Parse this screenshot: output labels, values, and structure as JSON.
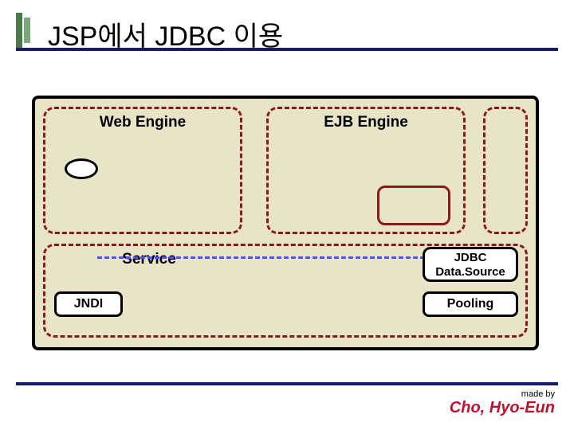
{
  "title": "JSP에서 JDBC 이용",
  "boxes": {
    "web_engine": "Web Engine",
    "ejb_engine": "EJB Engine",
    "service": "Service",
    "jdbc_ds_line1": "JDBC",
    "jdbc_ds_line2": "Data.Source",
    "jndi": "JNDI",
    "pooling": "Pooling"
  },
  "credit": {
    "made_by": "made by",
    "author": "Cho, Hyo-Eun"
  }
}
